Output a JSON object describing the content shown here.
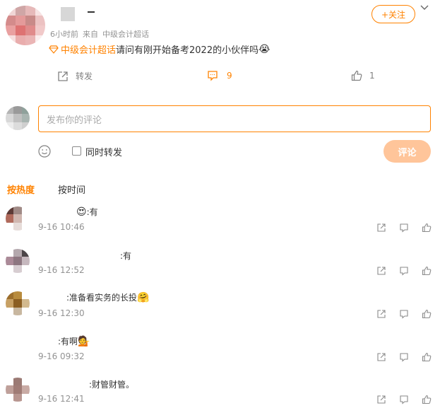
{
  "post": {
    "meta_time": "6小时前",
    "meta_source": "来自",
    "meta_topic": "中级会计超话",
    "follow_label": "+关注",
    "topic_link": "中级会计超话",
    "body": "请问有刚开始备考2022的小伙伴吗",
    "forward_label": "转发",
    "comment_count": "9",
    "like_count": "1"
  },
  "composer": {
    "placeholder": "发布你的评论",
    "repost_label": "同时转发",
    "submit_label": "评论"
  },
  "sort_tabs": [
    "按热度",
    "按时间"
  ],
  "comments": [
    {
      "text": ":有",
      "time": "9-16 10:46"
    },
    {
      "text": ":有",
      "time": "9-16 12:52"
    },
    {
      "text": ":准备看实务的长投",
      "time": "9-16 12:30"
    },
    {
      "text": ":有啊",
      "time": "9-16 09:32"
    },
    {
      "text": ":财管财管。",
      "time": "9-16 12:41"
    }
  ],
  "colors": {
    "accent": "#ff8200",
    "muted": "#939393",
    "submit_disabled": "#ffc59a"
  }
}
